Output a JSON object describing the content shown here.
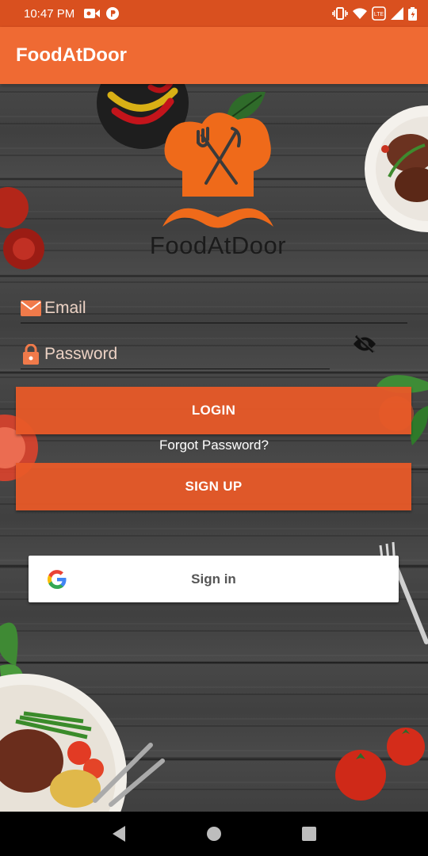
{
  "status_bar": {
    "time": "10:47 PM",
    "left_icons": [
      "video-camera-icon",
      "p-icon"
    ],
    "right_icons": [
      "vibrate-icon",
      "wifi-icon",
      "volte-icon",
      "signal-icon",
      "battery-icon"
    ],
    "volte_label": "LTE"
  },
  "app_bar": {
    "title": "FoodAtDoor"
  },
  "logo": {
    "text": "FoodAtDoor"
  },
  "form": {
    "email_placeholder": "Email",
    "password_placeholder": "Password",
    "email_value": "",
    "password_value": ""
  },
  "buttons": {
    "login": "LOGIN",
    "forgot": "Forgot Password?",
    "signup": "SIGN UP",
    "google_sign_in": "Sign in"
  },
  "colors": {
    "status_bar": "#d9501f",
    "app_bar": "#ef6a33",
    "button": "#e85a28",
    "icon_accent": "#f07a4a"
  },
  "nav": [
    "back-icon",
    "home-icon",
    "recents-icon"
  ]
}
